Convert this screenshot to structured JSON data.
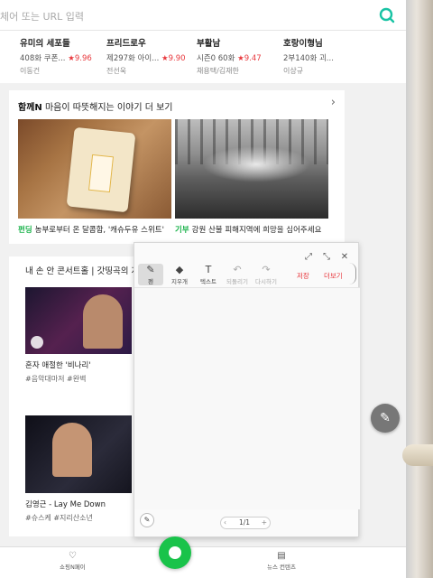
{
  "urlbar": {
    "placeholder": "체어 또는 URL 입력"
  },
  "movies": [
    {
      "title": "유미의 세포들",
      "sub": "408화 쿠폰...",
      "rating": "9.96",
      "people": "이동건"
    },
    {
      "title": "프리드로우",
      "sub": "제297화 아이...",
      "rating": "9.90",
      "people": "전선욱"
    },
    {
      "title": "부활남",
      "sub": "시즌0 60화",
      "rating": "9.47",
      "people": "채용택/김재한"
    },
    {
      "title": "호랑이형님",
      "sub": "2부140화 괴...",
      "rating": "",
      "people": "이상규"
    }
  ],
  "rating_star": "★",
  "card1": {
    "brand": "함께N",
    "title": "마음이 따뜻해지는 이야기 더 보기",
    "stories": [
      {
        "tag": "펀딩",
        "caption": "농부로부터 온 달콤함, '캐슈두유 스위트'"
      },
      {
        "tag": "기부",
        "caption": "강원 산불 피해지역에 희망을 심어주세요"
      }
    ]
  },
  "card2": {
    "title": "내 손 안 콘서트홀 | 갓띵곡의 지",
    "videos": [
      {
        "title": "혼자 애절한 '비나리'",
        "tags": "#음악대마저 #완벽"
      },
      {
        "title": "김영근 - Lay Me Down",
        "tags": "#슈스케 #지리산소년"
      }
    ]
  },
  "memo": {
    "tools": [
      {
        "label": "펜",
        "icon": "✎"
      },
      {
        "label": "지우개",
        "icon": "◆"
      },
      {
        "label": "텍스트",
        "icon": "T"
      },
      {
        "label": "되돌리기",
        "icon": "↶"
      },
      {
        "label": "다시하기",
        "icon": "↷"
      }
    ],
    "save_label": "저장",
    "more_label": "더보기",
    "page_indicator": "1/1"
  },
  "bottom_nav": {
    "left_label": "쇼핑N페이",
    "right_label": "뉴스 컨텐츠"
  },
  "colors": {
    "accent_green": "#19c34a",
    "rating_red": "#e8383d",
    "tag_green": "#19b24a"
  }
}
